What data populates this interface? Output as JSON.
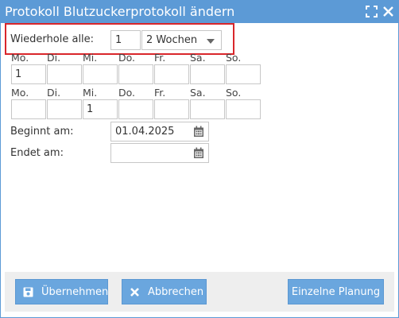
{
  "dialog": {
    "title": "Protokoll Blutzuckerprotokoll ändern"
  },
  "repeat": {
    "label": "Wiederhole alle:",
    "count": "1",
    "interval": "2 Wochen"
  },
  "weeks": [
    {
      "days": [
        "Mo.",
        "Di.",
        "Mi.",
        "Do.",
        "Fr.",
        "Sa.",
        "So."
      ],
      "values": [
        "1",
        "",
        "",
        "",
        "",
        "",
        ""
      ]
    },
    {
      "days": [
        "Mo.",
        "Di.",
        "Mi.",
        "Do.",
        "Fr.",
        "Sa.",
        "So."
      ],
      "values": [
        "",
        "",
        "1",
        "",
        "",
        "",
        ""
      ]
    }
  ],
  "start": {
    "label": "Beginnt am:",
    "value": "01.04.2025"
  },
  "end": {
    "label": "Endet am:",
    "value": ""
  },
  "buttons": {
    "apply": "Übernehmen",
    "cancel": "Abbrechen",
    "single": "Einzelne Planung"
  },
  "icons": {
    "maximize": "expand-icon",
    "close": "close-icon",
    "calendar": "calendar-icon",
    "apply": "save-icon",
    "cancel": "x-icon"
  },
  "colors": {
    "titlebar": "#5c9ad6",
    "button": "#6aa6de",
    "highlight": "#d9262b"
  }
}
